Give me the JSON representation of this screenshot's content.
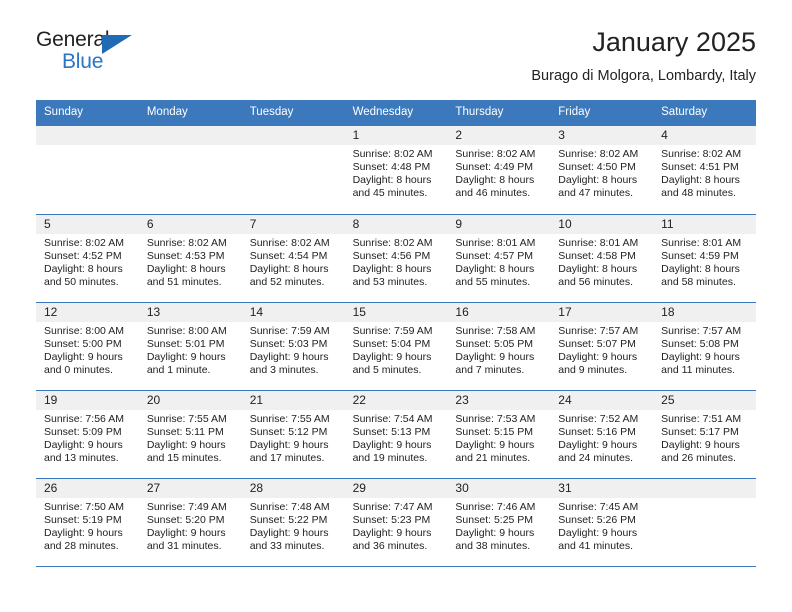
{
  "logo": {
    "word_top": "General",
    "word_bottom": "Blue",
    "triangle_icon": "triangle-icon",
    "color_dark": "#231f20",
    "color_blue": "#2a76c4"
  },
  "header": {
    "title": "January 2025",
    "subtitle": "Burago di Molgora, Lombardy, Italy"
  },
  "theme": {
    "header_blue": "#3b79bc",
    "day_band_gray": "#f0f0f0",
    "text": "#222222"
  },
  "weekday_headers": [
    "Sunday",
    "Monday",
    "Tuesday",
    "Wednesday",
    "Thursday",
    "Friday",
    "Saturday"
  ],
  "weeks": [
    [
      {
        "day": "",
        "sunrise": "",
        "sunset": "",
        "daylight1": "",
        "daylight2": ""
      },
      {
        "day": "",
        "sunrise": "",
        "sunset": "",
        "daylight1": "",
        "daylight2": ""
      },
      {
        "day": "",
        "sunrise": "",
        "sunset": "",
        "daylight1": "",
        "daylight2": ""
      },
      {
        "day": "1",
        "sunrise": "Sunrise: 8:02 AM",
        "sunset": "Sunset: 4:48 PM",
        "daylight1": "Daylight: 8 hours",
        "daylight2": "and 45 minutes."
      },
      {
        "day": "2",
        "sunrise": "Sunrise: 8:02 AM",
        "sunset": "Sunset: 4:49 PM",
        "daylight1": "Daylight: 8 hours",
        "daylight2": "and 46 minutes."
      },
      {
        "day": "3",
        "sunrise": "Sunrise: 8:02 AM",
        "sunset": "Sunset: 4:50 PM",
        "daylight1": "Daylight: 8 hours",
        "daylight2": "and 47 minutes."
      },
      {
        "day": "4",
        "sunrise": "Sunrise: 8:02 AM",
        "sunset": "Sunset: 4:51 PM",
        "daylight1": "Daylight: 8 hours",
        "daylight2": "and 48 minutes."
      }
    ],
    [
      {
        "day": "5",
        "sunrise": "Sunrise: 8:02 AM",
        "sunset": "Sunset: 4:52 PM",
        "daylight1": "Daylight: 8 hours",
        "daylight2": "and 50 minutes."
      },
      {
        "day": "6",
        "sunrise": "Sunrise: 8:02 AM",
        "sunset": "Sunset: 4:53 PM",
        "daylight1": "Daylight: 8 hours",
        "daylight2": "and 51 minutes."
      },
      {
        "day": "7",
        "sunrise": "Sunrise: 8:02 AM",
        "sunset": "Sunset: 4:54 PM",
        "daylight1": "Daylight: 8 hours",
        "daylight2": "and 52 minutes."
      },
      {
        "day": "8",
        "sunrise": "Sunrise: 8:02 AM",
        "sunset": "Sunset: 4:56 PM",
        "daylight1": "Daylight: 8 hours",
        "daylight2": "and 53 minutes."
      },
      {
        "day": "9",
        "sunrise": "Sunrise: 8:01 AM",
        "sunset": "Sunset: 4:57 PM",
        "daylight1": "Daylight: 8 hours",
        "daylight2": "and 55 minutes."
      },
      {
        "day": "10",
        "sunrise": "Sunrise: 8:01 AM",
        "sunset": "Sunset: 4:58 PM",
        "daylight1": "Daylight: 8 hours",
        "daylight2": "and 56 minutes."
      },
      {
        "day": "11",
        "sunrise": "Sunrise: 8:01 AM",
        "sunset": "Sunset: 4:59 PM",
        "daylight1": "Daylight: 8 hours",
        "daylight2": "and 58 minutes."
      }
    ],
    [
      {
        "day": "12",
        "sunrise": "Sunrise: 8:00 AM",
        "sunset": "Sunset: 5:00 PM",
        "daylight1": "Daylight: 9 hours",
        "daylight2": "and 0 minutes."
      },
      {
        "day": "13",
        "sunrise": "Sunrise: 8:00 AM",
        "sunset": "Sunset: 5:01 PM",
        "daylight1": "Daylight: 9 hours",
        "daylight2": "and 1 minute."
      },
      {
        "day": "14",
        "sunrise": "Sunrise: 7:59 AM",
        "sunset": "Sunset: 5:03 PM",
        "daylight1": "Daylight: 9 hours",
        "daylight2": "and 3 minutes."
      },
      {
        "day": "15",
        "sunrise": "Sunrise: 7:59 AM",
        "sunset": "Sunset: 5:04 PM",
        "daylight1": "Daylight: 9 hours",
        "daylight2": "and 5 minutes."
      },
      {
        "day": "16",
        "sunrise": "Sunrise: 7:58 AM",
        "sunset": "Sunset: 5:05 PM",
        "daylight1": "Daylight: 9 hours",
        "daylight2": "and 7 minutes."
      },
      {
        "day": "17",
        "sunrise": "Sunrise: 7:57 AM",
        "sunset": "Sunset: 5:07 PM",
        "daylight1": "Daylight: 9 hours",
        "daylight2": "and 9 minutes."
      },
      {
        "day": "18",
        "sunrise": "Sunrise: 7:57 AM",
        "sunset": "Sunset: 5:08 PM",
        "daylight1": "Daylight: 9 hours",
        "daylight2": "and 11 minutes."
      }
    ],
    [
      {
        "day": "19",
        "sunrise": "Sunrise: 7:56 AM",
        "sunset": "Sunset: 5:09 PM",
        "daylight1": "Daylight: 9 hours",
        "daylight2": "and 13 minutes."
      },
      {
        "day": "20",
        "sunrise": "Sunrise: 7:55 AM",
        "sunset": "Sunset: 5:11 PM",
        "daylight1": "Daylight: 9 hours",
        "daylight2": "and 15 minutes."
      },
      {
        "day": "21",
        "sunrise": "Sunrise: 7:55 AM",
        "sunset": "Sunset: 5:12 PM",
        "daylight1": "Daylight: 9 hours",
        "daylight2": "and 17 minutes."
      },
      {
        "day": "22",
        "sunrise": "Sunrise: 7:54 AM",
        "sunset": "Sunset: 5:13 PM",
        "daylight1": "Daylight: 9 hours",
        "daylight2": "and 19 minutes."
      },
      {
        "day": "23",
        "sunrise": "Sunrise: 7:53 AM",
        "sunset": "Sunset: 5:15 PM",
        "daylight1": "Daylight: 9 hours",
        "daylight2": "and 21 minutes."
      },
      {
        "day": "24",
        "sunrise": "Sunrise: 7:52 AM",
        "sunset": "Sunset: 5:16 PM",
        "daylight1": "Daylight: 9 hours",
        "daylight2": "and 24 minutes."
      },
      {
        "day": "25",
        "sunrise": "Sunrise: 7:51 AM",
        "sunset": "Sunset: 5:17 PM",
        "daylight1": "Daylight: 9 hours",
        "daylight2": "and 26 minutes."
      }
    ],
    [
      {
        "day": "26",
        "sunrise": "Sunrise: 7:50 AM",
        "sunset": "Sunset: 5:19 PM",
        "daylight1": "Daylight: 9 hours",
        "daylight2": "and 28 minutes."
      },
      {
        "day": "27",
        "sunrise": "Sunrise: 7:49 AM",
        "sunset": "Sunset: 5:20 PM",
        "daylight1": "Daylight: 9 hours",
        "daylight2": "and 31 minutes."
      },
      {
        "day": "28",
        "sunrise": "Sunrise: 7:48 AM",
        "sunset": "Sunset: 5:22 PM",
        "daylight1": "Daylight: 9 hours",
        "daylight2": "and 33 minutes."
      },
      {
        "day": "29",
        "sunrise": "Sunrise: 7:47 AM",
        "sunset": "Sunset: 5:23 PM",
        "daylight1": "Daylight: 9 hours",
        "daylight2": "and 36 minutes."
      },
      {
        "day": "30",
        "sunrise": "Sunrise: 7:46 AM",
        "sunset": "Sunset: 5:25 PM",
        "daylight1": "Daylight: 9 hours",
        "daylight2": "and 38 minutes."
      },
      {
        "day": "31",
        "sunrise": "Sunrise: 7:45 AM",
        "sunset": "Sunset: 5:26 PM",
        "daylight1": "Daylight: 9 hours",
        "daylight2": "and 41 minutes."
      },
      {
        "day": "",
        "sunrise": "",
        "sunset": "",
        "daylight1": "",
        "daylight2": ""
      }
    ]
  ]
}
